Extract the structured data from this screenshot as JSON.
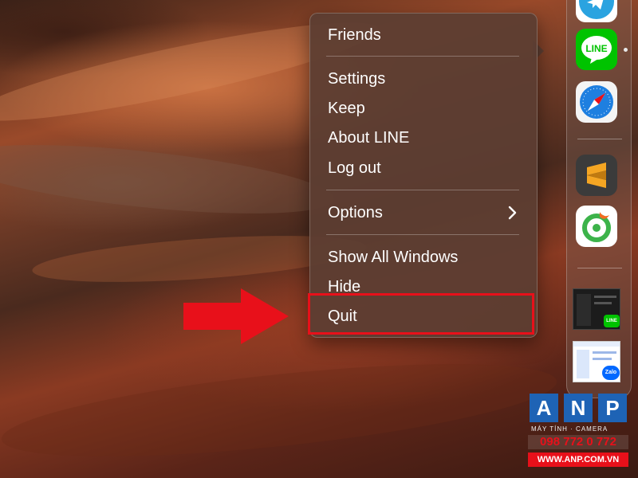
{
  "menu": {
    "items": [
      {
        "label": "Friends"
      },
      {
        "label": "Settings"
      },
      {
        "label": "Keep"
      },
      {
        "label": "About LINE"
      },
      {
        "label": "Log out"
      },
      {
        "label": "Options",
        "has_submenu": true
      },
      {
        "label": "Show All Windows"
      },
      {
        "label": "Hide"
      },
      {
        "label": "Quit",
        "highlighted": true
      }
    ]
  },
  "dock": {
    "apps": [
      {
        "name": "Telegram",
        "icon": "telegram-icon"
      },
      {
        "name": "LINE",
        "icon": "line-app-icon",
        "label": "LINE",
        "running": true
      },
      {
        "name": "Safari",
        "icon": "safari-compass-icon"
      },
      {
        "name": "Sublime Text",
        "icon": "sublime-text-icon"
      },
      {
        "name": "Coc Coc",
        "icon": "coccoc-browser-icon"
      }
    ],
    "windows": [
      {
        "app": "LINE",
        "badge": "LINE"
      },
      {
        "app": "Zalo",
        "badge": "Zalo"
      }
    ]
  },
  "annotation": {
    "arrow_color": "#e8101a",
    "highlight_color": "#e8101a"
  },
  "watermark": {
    "letters": [
      "A",
      "N",
      "P"
    ],
    "tagline": "MÁY TÍNH · CAMERA",
    "phone": "098 772 0 772",
    "url": "WWW.ANP.COM.VN"
  },
  "colors": {
    "line_green": "#00c300",
    "safari_blue": "#1e7fe0",
    "sublime_orange": "#f5a623",
    "anp_blue": "#1e63b5"
  }
}
